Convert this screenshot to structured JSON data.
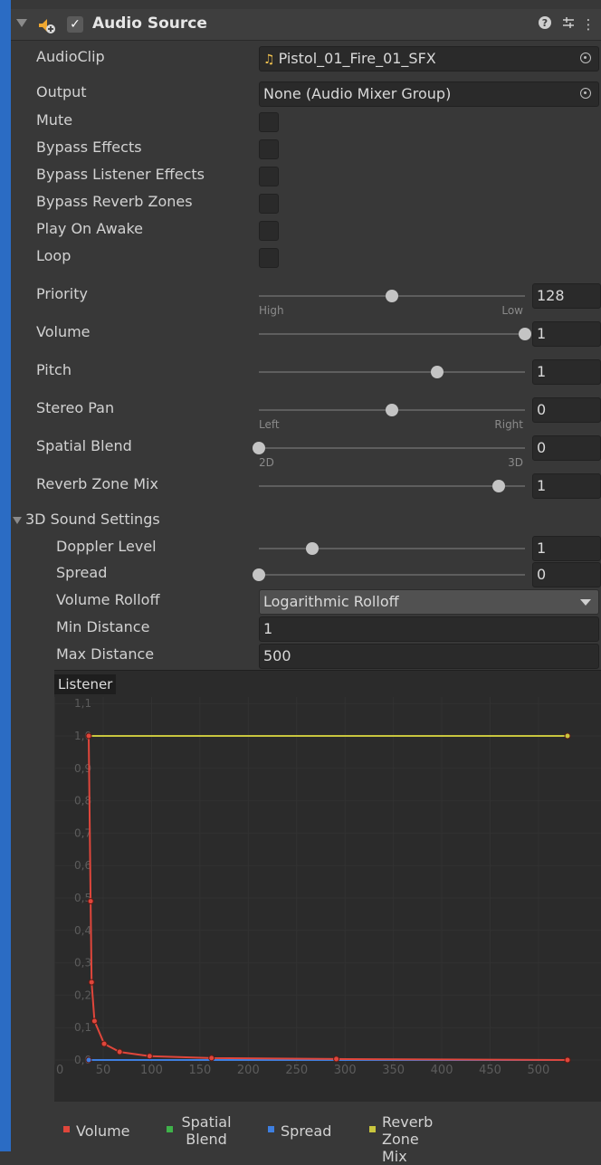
{
  "component": {
    "title": "Audio Source",
    "enabled": true,
    "icons": [
      "audio-source-component-icon",
      "help-icon",
      "presets-icon",
      "kebab-menu-icon"
    ]
  },
  "fields": {
    "audio_clip": {
      "label": "AudioClip",
      "value": "Pistol_01_Fire_01_SFX"
    },
    "output": {
      "label": "Output",
      "value": "None (Audio Mixer Group)"
    },
    "mute": {
      "label": "Mute",
      "checked": false
    },
    "bypass_effects": {
      "label": "Bypass Effects",
      "checked": false
    },
    "bypass_listener_effects": {
      "label": "Bypass Listener Effects",
      "checked": false
    },
    "bypass_reverb_zones": {
      "label": "Bypass Reverb Zones",
      "checked": false
    },
    "play_on_awake": {
      "label": "Play On Awake",
      "checked": false
    },
    "loop": {
      "label": "Loop",
      "checked": false
    },
    "priority": {
      "label": "Priority",
      "value": "128",
      "min_caption": "High",
      "max_caption": "Low",
      "fraction": 0.5
    },
    "volume": {
      "label": "Volume",
      "value": "1",
      "fraction": 1.0
    },
    "pitch": {
      "label": "Pitch",
      "value": "1",
      "fraction": 0.67
    },
    "stereo_pan": {
      "label": "Stereo Pan",
      "value": "0",
      "min_caption": "Left",
      "max_caption": "Right",
      "fraction": 0.5
    },
    "spatial_blend": {
      "label": "Spatial Blend",
      "value": "0",
      "min_caption": "2D",
      "max_caption": "3D",
      "fraction": 0.0
    },
    "reverb_zone_mix": {
      "label": "Reverb Zone Mix",
      "value": "1",
      "fraction": 0.9
    }
  },
  "sound_3d": {
    "section_label": "3D Sound Settings",
    "doppler_level": {
      "label": "Doppler Level",
      "value": "1",
      "fraction": 0.2
    },
    "spread": {
      "label": "Spread",
      "value": "0",
      "fraction": 0.0
    },
    "volume_rolloff": {
      "label": "Volume Rolloff",
      "value": "Logarithmic Rolloff"
    },
    "min_distance": {
      "label": "Min Distance",
      "value": "1"
    },
    "max_distance": {
      "label": "Max Distance",
      "value": "500"
    }
  },
  "graph": {
    "listener_label": "Listener",
    "colors": {
      "volume": "#e0463b",
      "spatial_blend": "#3fb24a",
      "spread": "#3e7fe0",
      "reverb_zone_mix": "#c9c63e"
    },
    "legend": [
      {
        "label": "Volume",
        "color": "#e0463b"
      },
      {
        "label": "Spatial Blend",
        "color": "#3fb24a"
      },
      {
        "label": "Spread",
        "color": "#3e7fe0"
      },
      {
        "label": "Reverb Zone Mix",
        "color": "#c9c63e"
      }
    ]
  },
  "chart_data": {
    "type": "line",
    "title": "",
    "xlabel": "",
    "ylabel": "",
    "xlim": [
      0,
      560
    ],
    "ylim": [
      0,
      1.1
    ],
    "x_ticks": [
      "0",
      "50",
      "100",
      "150",
      "200",
      "250",
      "300",
      "350",
      "400",
      "450",
      "500"
    ],
    "y_ticks": [
      "0,0",
      "0,1",
      "0,2",
      "0,3",
      "0,4",
      "0,5",
      "0,6",
      "0,7",
      "0,8",
      "0,9",
      "1,0",
      "1,1"
    ],
    "grid": true,
    "series": [
      {
        "name": "Volume",
        "points": [
          [
            35,
            1.0
          ],
          [
            37,
            0.49
          ],
          [
            38,
            0.24
          ],
          [
            41,
            0.12
          ],
          [
            51,
            0.05
          ],
          [
            67,
            0.025
          ],
          [
            98,
            0.012
          ],
          [
            162,
            0.006
          ],
          [
            291,
            0.003
          ],
          [
            530,
            0.0
          ]
        ]
      },
      {
        "name": "Spatial Blend",
        "points": [
          [
            35,
            0.0
          ],
          [
            530,
            0.0
          ]
        ]
      },
      {
        "name": "Spread",
        "points": [
          [
            35,
            0.0
          ],
          [
            530,
            0.0
          ]
        ]
      },
      {
        "name": "Reverb Zone Mix",
        "points": [
          [
            35,
            1.0
          ],
          [
            530,
            1.0
          ]
        ]
      }
    ]
  }
}
